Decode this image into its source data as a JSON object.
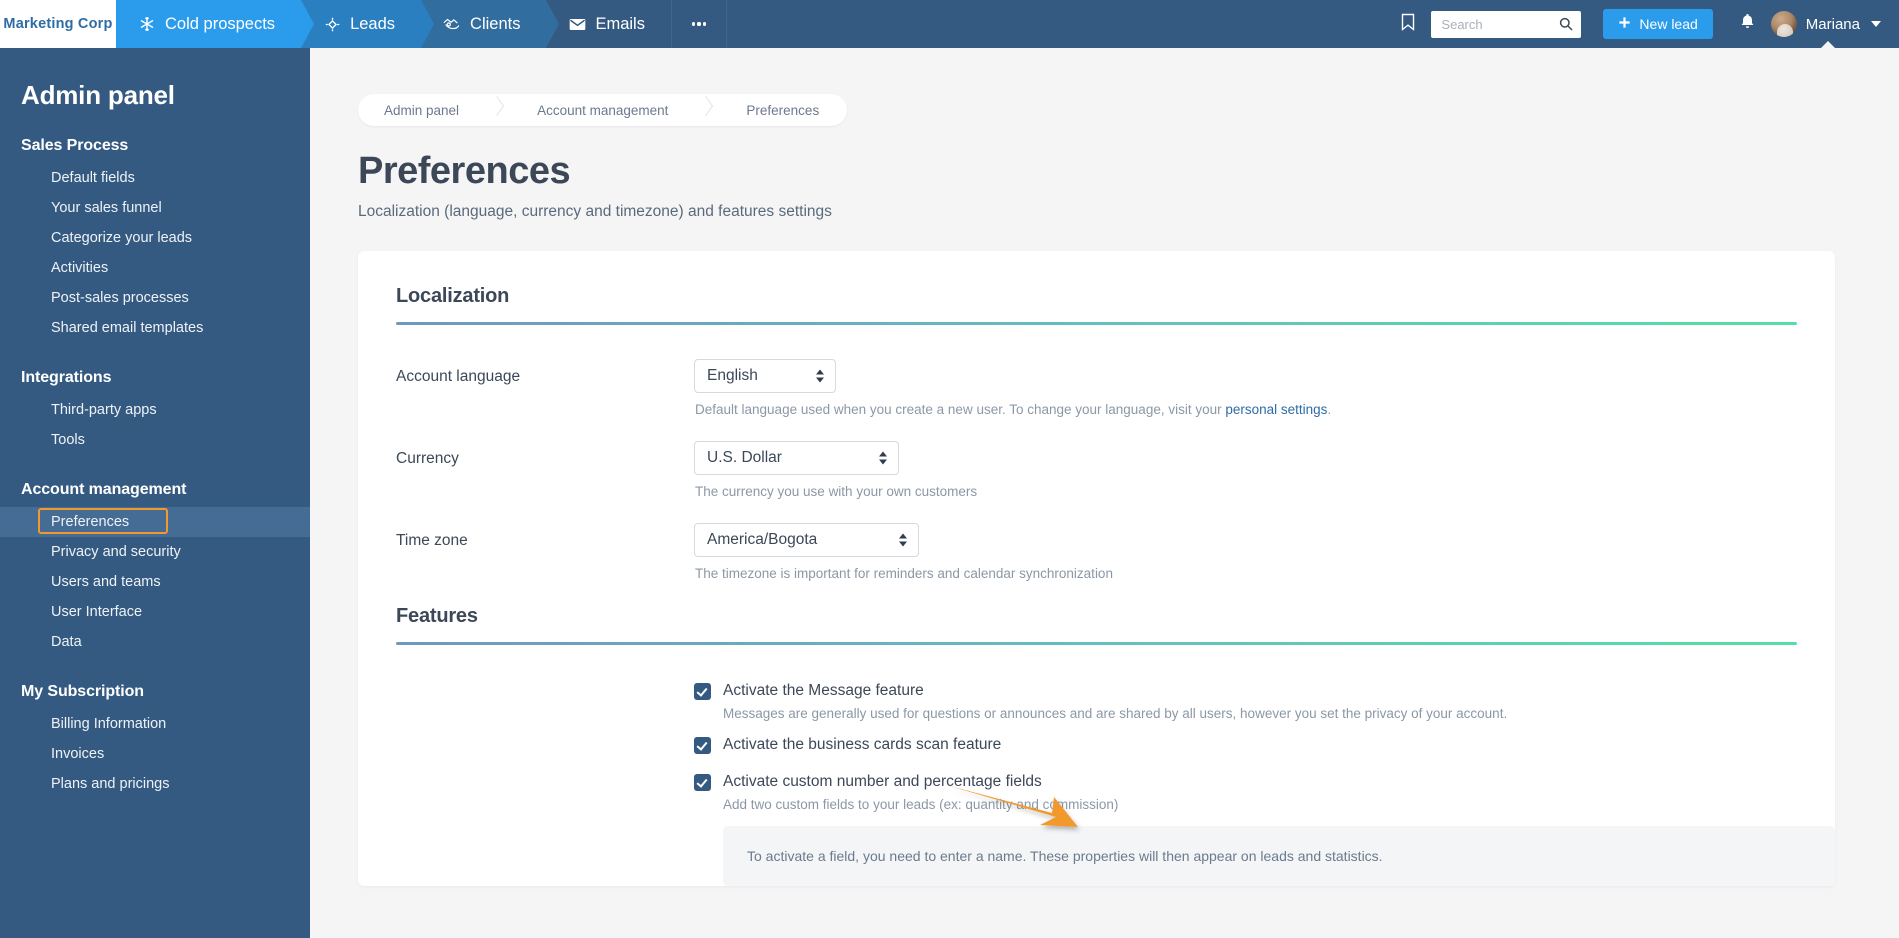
{
  "topbar": {
    "logo": "Marketing Corp",
    "tabs": [
      {
        "label": "Cold prospects",
        "icon": "snowflake-icon",
        "color": "#2b9bec"
      },
      {
        "label": "Leads",
        "icon": "target-diamond-icon",
        "color": "#2a7fc0"
      },
      {
        "label": "Clients",
        "icon": "handshake-icon",
        "color": "#326d9f"
      },
      {
        "label": "Emails",
        "icon": "envelope-icon",
        "color": "#345a82"
      }
    ],
    "more_label": "more-menu",
    "bookmark_icon": "bookmark-icon",
    "search": {
      "value": "",
      "placeholder": "Search",
      "icon": "search-icon"
    },
    "new_lead_label": "New lead",
    "notifications_icon": "bell-icon",
    "user_name": "Mariana",
    "accent": "#2b9bec",
    "bar_color": "#345a82"
  },
  "sidebar": {
    "title": "Admin panel",
    "groups": [
      {
        "title": "Sales Process",
        "items": [
          {
            "label": "Default fields",
            "active": false
          },
          {
            "label": "Your sales funnel",
            "active": false
          },
          {
            "label": "Categorize your leads",
            "active": false
          },
          {
            "label": "Activities",
            "active": false
          },
          {
            "label": "Post-sales processes",
            "active": false
          },
          {
            "label": "Shared email templates",
            "active": false
          }
        ]
      },
      {
        "title": "Integrations",
        "items": [
          {
            "label": "Third-party apps",
            "active": false
          },
          {
            "label": "Tools",
            "active": false
          }
        ]
      },
      {
        "title": "Account management",
        "items": [
          {
            "label": "Preferences",
            "active": true
          },
          {
            "label": "Privacy and security",
            "active": false
          },
          {
            "label": "Users and teams",
            "active": false
          },
          {
            "label": "User Interface",
            "active": false
          },
          {
            "label": "Data",
            "active": false
          }
        ]
      },
      {
        "title": "My Subscription",
        "items": [
          {
            "label": "Billing Information",
            "active": false
          },
          {
            "label": "Invoices",
            "active": false
          },
          {
            "label": "Plans and pricings",
            "active": false
          }
        ]
      }
    ],
    "highlight_color": "#f2992e"
  },
  "breadcrumb": [
    "Admin panel",
    "Account management",
    "Preferences"
  ],
  "page": {
    "title": "Preferences",
    "subtitle": "Localization (language, currency and timezone) and features settings"
  },
  "localization": {
    "heading": "Localization",
    "fields": [
      {
        "label": "Account language",
        "value": "English",
        "helper_before": "Default language used when you create a new user. To change your language, visit your ",
        "helper_link": "personal settings",
        "helper_after": "."
      },
      {
        "label": "Currency",
        "value": "U.S. Dollar",
        "helper_before": "The currency you use with your own customers",
        "helper_link": "",
        "helper_after": ""
      },
      {
        "label": "Time zone",
        "value": "America/Bogota",
        "helper_before": "The timezone is important for reminders and calendar synchronization",
        "helper_link": "",
        "helper_after": ""
      }
    ]
  },
  "features": {
    "heading": "Features",
    "items": [
      {
        "checked": true,
        "label": "Activate the Message feature",
        "help": "Messages are generally used for questions or announces and are shared by all users, however you set the privacy of your account."
      },
      {
        "checked": true,
        "label": "Activate the business cards scan feature",
        "help": ""
      },
      {
        "checked": true,
        "label": "Activate custom number and percentage fields",
        "help": "Add two custom fields to your leads (ex: quantity and commission)"
      }
    ],
    "info_box": "To activate a field, you need to enter a name. These properties will then appear on leads and statistics."
  },
  "annotation": {
    "type": "arrow",
    "color": "#f2992e",
    "points_to": "Time zone select"
  }
}
